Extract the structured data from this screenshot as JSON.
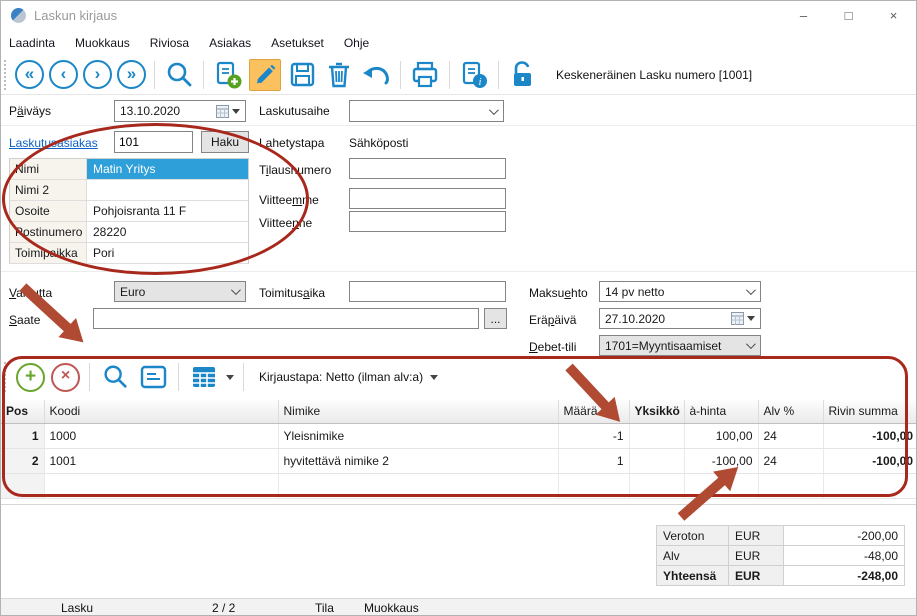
{
  "window": {
    "title": "Laskun kirjaus",
    "controls": {
      "minimize": "–",
      "maximize": "□",
      "close": "×"
    }
  },
  "menu": {
    "items": [
      "Laadinta",
      "Muokkaus",
      "Riviosa",
      "Asiakas",
      "Asetukset",
      "Ohje"
    ]
  },
  "toolbar": {
    "nav": [
      "«",
      "‹",
      "›",
      "»"
    ],
    "status": "Keskeneräinen Lasku numero [1001]"
  },
  "fields": {
    "paivays": {
      "pre": "P",
      "key": "ä",
      "post": "iväys",
      "value": "13.10.2020"
    },
    "laskutusaihe": {
      "label": "Laskutusaihe",
      "value": ""
    },
    "laskutusasiakas": {
      "label": "Laskutusasiakas",
      "number": "101",
      "haku": "Haku"
    },
    "lahetystapa": {
      "label": "Lahetystapa",
      "value": "Sähköposti"
    },
    "tilausnumero": {
      "pre": "T",
      "key": "i",
      "post": "lausnumero",
      "value": ""
    },
    "viitteemme": {
      "pre": "Viittee",
      "key": "m",
      "post": "me",
      "value": ""
    },
    "viitteenne": {
      "pre": "Viittee",
      "key": "n",
      "post": "ne",
      "value": ""
    },
    "valuutta": {
      "pre": "",
      "key": "V",
      "post": "aluutta",
      "value": "Euro"
    },
    "toimitusaika": {
      "pre": "Toimitus",
      "key": "a",
      "post": "ika",
      "value": ""
    },
    "maksuehto": {
      "pre": "Maksu",
      "key": "e",
      "post": "hto",
      "value": "14 pv netto"
    },
    "saate": {
      "pre": "",
      "key": "S",
      "post": "aate",
      "value": "",
      "more": "..."
    },
    "erapaiva": {
      "pre": "Erä",
      "key": "p",
      "post": "äivä",
      "value": "27.10.2020"
    },
    "debet_tili": {
      "pre": "",
      "key": "D",
      "post": "ebet-tili",
      "value": "1701=Myyntisaamiset"
    }
  },
  "customer": {
    "rows": [
      {
        "label": "Nimi",
        "value": "Matin Yritys"
      },
      {
        "label": "Nimi 2",
        "value": ""
      },
      {
        "label": "Osoite",
        "value": "Pohjoisranta 11 F"
      },
      {
        "label": "Postinumero",
        "value": "28220"
      },
      {
        "label": "Toimipaikka",
        "value": "Pori"
      }
    ]
  },
  "items": {
    "kirjaustapa": "Kirjaustapa: Netto (ilman alv:a)",
    "columns": [
      "Pos",
      "Koodi",
      "Nimike",
      "Määrä",
      "Yksikkö",
      "à-hinta",
      "Alv %",
      "Rivin summa"
    ],
    "rows": [
      {
        "pos": "1",
        "koodi": "1000",
        "nimike": "Yleisnimike",
        "maara": "-1",
        "yksikko": "",
        "ahinta": "100,00",
        "alv": "24",
        "summa": "-100,00"
      },
      {
        "pos": "2",
        "koodi": "1001",
        "nimike": "hyvitettävä nimike 2",
        "maara": "1",
        "yksikko": "",
        "ahinta": "-100,00",
        "alv": "24",
        "summa": "-100,00"
      }
    ]
  },
  "totals": {
    "rows": [
      {
        "label": "Veroton",
        "currency": "EUR",
        "value": "-200,00"
      },
      {
        "label": "Alv",
        "currency": "EUR",
        "value": "-48,00"
      },
      {
        "label": "Yhteensä",
        "currency": "EUR",
        "value": "-248,00"
      }
    ]
  },
  "statusbar": {
    "doc_type": "Lasku",
    "page": "2 / 2",
    "tila_label": "Tila",
    "tila_value": "Muokkaus"
  },
  "colors": {
    "accent_blue": "#1b86c8",
    "selection_blue": "#2e9fd9",
    "annotation_red": "#a8281c",
    "arrow_red": "#b14a33",
    "highlight_orange": "#fcc15f",
    "top_accent_teal": "#17857b"
  }
}
